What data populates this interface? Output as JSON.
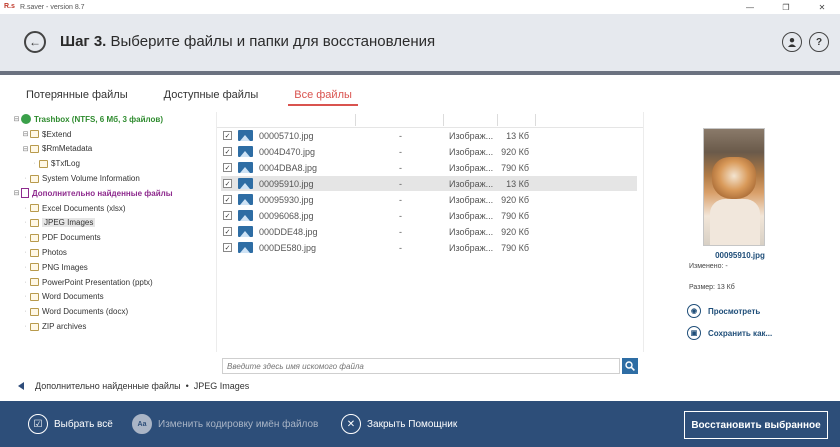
{
  "window": {
    "logo": "R.s",
    "title": "R.saver - version 8.7",
    "minimize": "—",
    "maximize": "❐",
    "close": "✕"
  },
  "header": {
    "step_label": "Шаг 3.",
    "step_text": "Выберите файлы и папки для восстановления",
    "user_icon": "user-icon",
    "help_icon": "help-icon",
    "progress": 1.0
  },
  "tabs": [
    {
      "label": "Потерянные файлы",
      "active": false
    },
    {
      "label": "Доступные файлы",
      "active": false
    },
    {
      "label": "Все файлы",
      "active": true
    }
  ],
  "tree": {
    "root": "Trashbox (NTFS, 6 Мб, 3 файлов)",
    "extend": "$Extend",
    "rmmetadata": "$RmMetadata",
    "txflog": "$TxfLog",
    "svi": "System Volume Information",
    "found": "Дополнительно найденные файлы",
    "found_items": [
      "Excel Documents (xlsx)",
      "JPEG Images",
      "PDF Documents",
      "Photos",
      "PNG Images",
      "PowerPoint Presentation (pptx)",
      "Word Documents",
      "Word Documents (docx)",
      "ZIP archives"
    ],
    "selected_index": 1
  },
  "files": [
    {
      "name": "00005710.jpg",
      "date": "-",
      "type": "Изображ...",
      "size": "13 Кб",
      "checked": true
    },
    {
      "name": "0004D470.jpg",
      "date": "-",
      "type": "Изображ...",
      "size": "920 Кб",
      "checked": true
    },
    {
      "name": "0004DBA8.jpg",
      "date": "-",
      "type": "Изображ...",
      "size": "790 Кб",
      "checked": true
    },
    {
      "name": "00095910.jpg",
      "date": "-",
      "type": "Изображ...",
      "size": "13 Кб",
      "checked": true
    },
    {
      "name": "00095930.jpg",
      "date": "-",
      "type": "Изображ...",
      "size": "920 Кб",
      "checked": true
    },
    {
      "name": "00096068.jpg",
      "date": "-",
      "type": "Изображ...",
      "size": "790 Кб",
      "checked": true
    },
    {
      "name": "000DDE48.jpg",
      "date": "-",
      "type": "Изображ...",
      "size": "920 Кб",
      "checked": true
    },
    {
      "name": "000DE580.jpg",
      "date": "-",
      "type": "Изображ...",
      "size": "790 Кб",
      "checked": true
    }
  ],
  "selected_file_index": 3,
  "search": {
    "placeholder": "Введите здесь имя искомого файла"
  },
  "preview": {
    "filename": "00095910.jpg",
    "modified": "Изменено: -",
    "size": "Размер: 13 Кб",
    "view_label": "Просмотреть",
    "save_label": "Сохранить как..."
  },
  "breadcrumb": {
    "path": "Дополнительно найденные файлы",
    "sep": "•",
    "current": "JPEG Images"
  },
  "footer": {
    "select_all": "Выбрать всё",
    "encoding": "Изменить кодировку имён файлов",
    "encoding_icon": "Aa",
    "close_wizard": "Закрыть Помощник",
    "restore": "Восстановить выбранное"
  },
  "colors": {
    "accent_red": "#d9534f",
    "footer_blue": "#2d4e79",
    "link_blue": "#1f4e79",
    "found_purple": "#8e2a8e",
    "trash_green": "#2e8b2e"
  }
}
